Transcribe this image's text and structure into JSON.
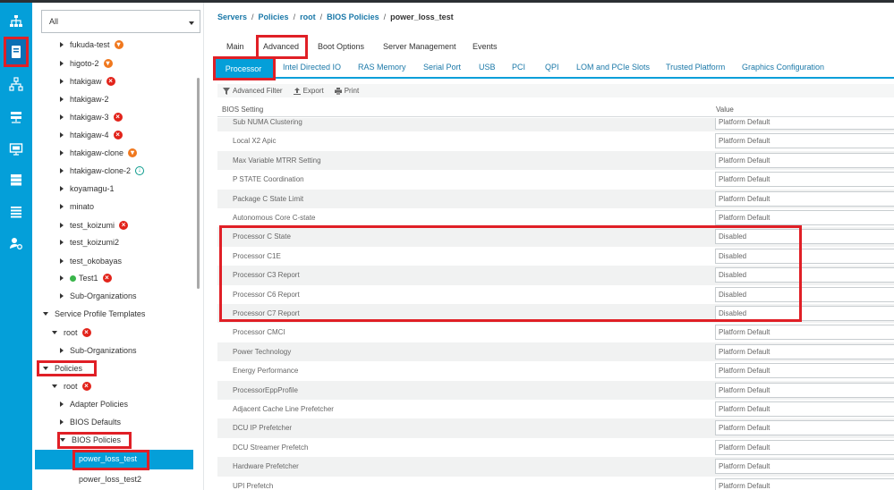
{
  "rail": {
    "icons": [
      "network-icon",
      "server-icon",
      "lan-icon",
      "san-icon",
      "vm-icon",
      "storage-icon",
      "chassis-icon",
      "admin-icon"
    ]
  },
  "nav": {
    "filter_value": "All",
    "tree": [
      {
        "label": "fukuda-test",
        "status": "orange"
      },
      {
        "label": "higoto-2",
        "status": "orange"
      },
      {
        "label": "htakigaw",
        "status": "red"
      },
      {
        "label": "htakigaw-2",
        "status": ""
      },
      {
        "label": "htakigaw-3",
        "status": "red"
      },
      {
        "label": "htakigaw-4",
        "status": "red"
      },
      {
        "label": "htakigaw-clone",
        "status": "orange"
      },
      {
        "label": "htakigaw-clone-2",
        "status": "teal"
      },
      {
        "label": "koyamagu-1",
        "status": ""
      },
      {
        "label": "minato",
        "status": ""
      },
      {
        "label": "test_koizumi",
        "status": "red"
      },
      {
        "label": "test_koizumi2",
        "status": ""
      },
      {
        "label": "test_okobayas",
        "status": ""
      },
      {
        "label": "Test1",
        "status": "red"
      },
      {
        "label": "Sub-Organizations",
        "status": ""
      },
      {
        "label": "Service Profile Templates",
        "status": ""
      },
      {
        "label": "root",
        "status": "red"
      },
      {
        "label": "Sub-Organizations",
        "status": ""
      },
      {
        "label": "Policies",
        "status": ""
      },
      {
        "label": "root",
        "status": "red"
      },
      {
        "label": "Adapter Policies",
        "status": ""
      },
      {
        "label": "BIOS Defaults",
        "status": ""
      },
      {
        "label": "BIOS Policies",
        "status": ""
      },
      {
        "label": "power_loss_test",
        "status": ""
      },
      {
        "label": "power_loss_test2",
        "status": ""
      }
    ]
  },
  "breadcrumb": {
    "servers": "Servers",
    "policies": "Policies",
    "root": "root",
    "bios_policies": "BIOS Policies",
    "current": "power_loss_test",
    "sep": "/"
  },
  "tabs": [
    "Main",
    "Advanced",
    "Boot Options",
    "Server Management",
    "Events"
  ],
  "subtabs": [
    "Processor",
    "Intel Directed IO",
    "RAS Memory",
    "Serial Port",
    "USB",
    "PCI",
    "QPI",
    "LOM and PCIe Slots",
    "Trusted Platform",
    "Graphics Configuration"
  ],
  "toolbar": {
    "advanced_filter": "Advanced Filter",
    "export": "Export",
    "print": "Print"
  },
  "table": {
    "headers": [
      "BIOS Setting",
      "Value"
    ],
    "rows": [
      {
        "setting": "Sub NUMA Clustering",
        "value": "Platform Default"
      },
      {
        "setting": "Local X2 Apic",
        "value": "Platform Default"
      },
      {
        "setting": "Max Variable MTRR Setting",
        "value": "Platform Default"
      },
      {
        "setting": "P STATE Coordination",
        "value": "Platform Default"
      },
      {
        "setting": "Package C State Limit",
        "value": "Platform Default"
      },
      {
        "setting": "Autonomous Core C-state",
        "value": "Platform Default"
      },
      {
        "setting": "Processor C State",
        "value": "Disabled"
      },
      {
        "setting": "Processor C1E",
        "value": "Disabled"
      },
      {
        "setting": "Processor C3 Report",
        "value": "Disabled"
      },
      {
        "setting": "Processor C6 Report",
        "value": "Disabled"
      },
      {
        "setting": "Processor C7 Report",
        "value": "Disabled"
      },
      {
        "setting": "Processor CMCI",
        "value": "Platform Default"
      },
      {
        "setting": "Power Technology",
        "value": "Platform Default"
      },
      {
        "setting": "Energy Performance",
        "value": "Platform Default"
      },
      {
        "setting": "ProcessorEppProfile",
        "value": "Platform Default"
      },
      {
        "setting": "Adjacent Cache Line Prefetcher",
        "value": "Platform Default"
      },
      {
        "setting": "DCU IP Prefetcher",
        "value": "Platform Default"
      },
      {
        "setting": "DCU Streamer Prefetch",
        "value": "Platform Default"
      },
      {
        "setting": "Hardware Prefetcher",
        "value": "Platform Default"
      },
      {
        "setting": "UPI Prefetch",
        "value": "Platform Default"
      }
    ]
  },
  "colors": {
    "accent": "#049fd9",
    "highlight_box": "#e01f26",
    "link": "#1a78a8"
  }
}
